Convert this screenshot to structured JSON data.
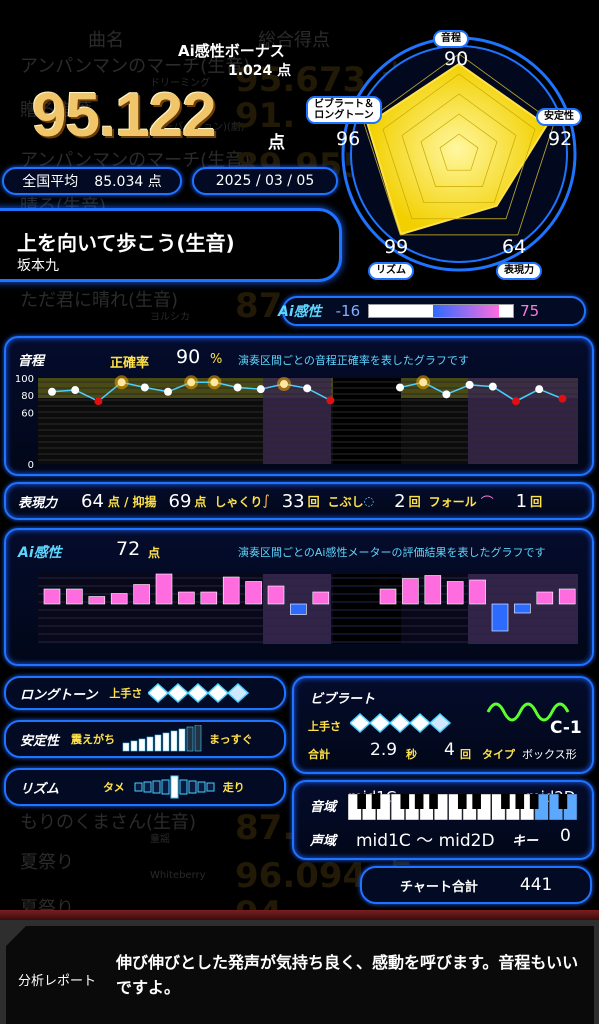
{
  "background": {
    "headers": {
      "song": "曲名",
      "score": "総合得点"
    },
    "rows": [
      {
        "title": "アンパンマンのマーチ(生音)",
        "artist": "ドリーミング",
        "score": "95.673",
        "unit": "点"
      },
      {
        "title": "贈る言葉",
        "artist": "(アーバージョン)(劇)",
        "score": "91.",
        "unit": ""
      },
      {
        "title": "アンパンマンのマーチ(生音)",
        "artist": "",
        "score": "89.955",
        "unit": ""
      },
      {
        "title": "晴る(生音)",
        "artist": "",
        "score": "",
        "unit": ""
      },
      {
        "title": "ただ君に晴れ(生音)",
        "artist": "ヨルシカ",
        "score": "87",
        "unit": ""
      },
      {
        "title": "もりのくまさん(生音)",
        "artist": "童謡",
        "score": "87.",
        "unit": ""
      },
      {
        "title": "夏祭り",
        "artist": "Whiteberry",
        "score": "96.094",
        "unit": "点"
      },
      {
        "title": "夏祭り",
        "artist": "",
        "score": "94",
        "unit": ""
      }
    ]
  },
  "header": {
    "bonus_label": "Ai感性ボーナス",
    "bonus_value": "1.024 点",
    "total_score": "95.122",
    "total_unit": "点",
    "national_average_label": "全国平均",
    "national_average_value": "85.034 点",
    "date": "2025 / 03 / 05"
  },
  "song": {
    "title": "上を向いて歩こう(生音)",
    "artist": "坂本九"
  },
  "radar": {
    "axes": [
      {
        "label": "音程",
        "value": 90
      },
      {
        "label": "安定性",
        "value": 92
      },
      {
        "label": "表現力",
        "value": 64
      },
      {
        "label": "リズム",
        "value": 99
      },
      {
        "label": "ビブラート＆\nロングトーン",
        "value": 96
      }
    ]
  },
  "ai_meter": {
    "logo": "Ai感性",
    "min": "-16",
    "max": "75"
  },
  "pitch": {
    "title": "音程",
    "accuracy_label": "正確率",
    "accuracy_value": "90",
    "accuracy_unit": "%",
    "description": "演奏区間ごとの音程正確率を表したグラフです",
    "y_ticks": [
      "100",
      "80",
      "60",
      "0"
    ],
    "points": [
      84,
      86,
      73,
      95,
      89,
      84,
      95,
      95,
      89,
      87,
      93,
      88,
      74,
      null,
      null,
      89,
      95,
      81,
      92,
      90,
      73,
      87,
      76
    ],
    "red_points": [
      2,
      12,
      20,
      22
    ],
    "star_points": [
      3,
      6,
      7,
      10,
      16
    ]
  },
  "expression": {
    "title": "表現力",
    "score": "64",
    "score_unit": "点 /",
    "yokuyo_label": "抑揚",
    "yokuyo_value": "69",
    "yokuyo_unit": "点",
    "shakuri_label": "しゃくり",
    "shakuri_value": "33",
    "shakuri_unit": "回",
    "kobushi_label": "こぶし",
    "kobushi_value": "2",
    "kobushi_unit": "回",
    "fall_label": "フォール",
    "fall_value": "1",
    "fall_unit": "回"
  },
  "ai_sense": {
    "title": "Ai感性",
    "score": "72",
    "score_unit": "点",
    "description": "演奏区間ごとのAi感性メーターの評価結果を表したグラフです",
    "bars": [
      0.5,
      0.5,
      0.25,
      0.35,
      0.65,
      1.0,
      0.4,
      0.4,
      0.9,
      0.75,
      0.6,
      -0.35,
      0.4,
      null,
      null,
      0.5,
      0.85,
      0.95,
      0.75,
      0.8,
      -0.9,
      -0.3,
      0.4,
      0.5
    ]
  },
  "long_tone": {
    "title": "ロングトーン",
    "skill_label": "上手さ",
    "level": 4.5
  },
  "stability": {
    "title": "安定性",
    "left_label": "震えがち",
    "right_label": "まっすぐ",
    "level": 0.8
  },
  "rhythm": {
    "title": "リズム",
    "left_label": "タメ",
    "right_label": "走り",
    "level": 0.5
  },
  "vibrato": {
    "title": "ビブラート",
    "skill_label": "上手さ",
    "level": 4.5,
    "type_code": "C-1",
    "total_label": "合計",
    "seconds": "2.9",
    "seconds_unit": "秒",
    "count": "4",
    "count_unit": "回",
    "type_label": "タイプ",
    "type_value": "ボックス形"
  },
  "range": {
    "tone_label": "音域",
    "low_note": "mid1C",
    "high_note": "mid2D",
    "voice_label": "声域",
    "voice_value": "mid1C 〜 mid2D",
    "key_label": "キー",
    "key_value": "0"
  },
  "chart_total": {
    "label": "チャート合計",
    "value": "441"
  },
  "report": {
    "label": "分析レポート",
    "text": "伸び伸びとした発声が気持ち良く、感動を呼びます。音程もいいですよ。"
  }
}
